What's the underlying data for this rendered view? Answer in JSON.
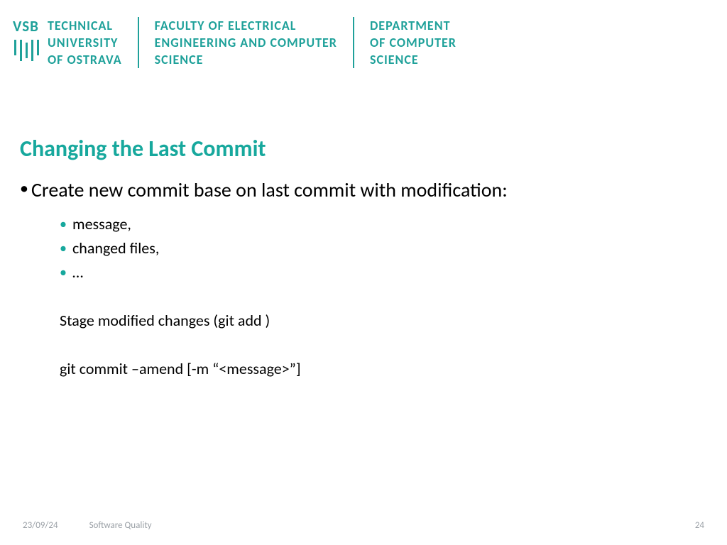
{
  "header": {
    "vsb": "VSB",
    "university": {
      "l1": "TECHNICAL",
      "l2": "UNIVERSITY",
      "l3": "OF OSTRAVA"
    },
    "faculty": {
      "l1": "FACULTY OF ELECTRICAL",
      "l2": "ENGINEERING AND COMPUTER",
      "l3": "SCIENCE"
    },
    "department": {
      "l1": "DEPARTMENT",
      "l2": "OF COMPUTER",
      "l3": "SCIENCE"
    }
  },
  "slide": {
    "title": "Changing the Last Commit",
    "bullet_main": "Create new commit base on last commit with modification:",
    "sub_bullets": [
      "message,",
      "changed files,",
      "…"
    ],
    "body_lines": [
      "Stage modified changes (git add )",
      "git commit –amend [-m “<message>”]"
    ]
  },
  "footer": {
    "date": "23/09/24",
    "course": "Software Quality",
    "page": "24"
  },
  "colors": {
    "accent": "#17a89d"
  }
}
